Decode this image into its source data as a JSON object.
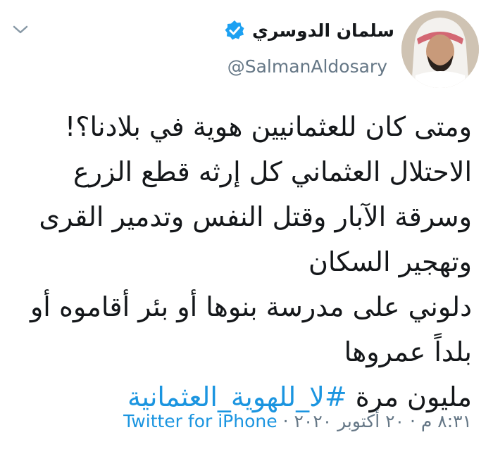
{
  "author": {
    "display_name": "سلمان الدوسري",
    "handle": "@SalmanAldosary",
    "verified_icon": "verified-badge-icon"
  },
  "tweet": {
    "lines": [
      "ومتى كان للعثمانيين هوية في بلادنا؟!",
      "الاحتلال العثماني كل إرثه قطع الزرع",
      "وسرقة الآبار وقتل النفس وتدمير القرى",
      "وتهجير السكان",
      "دلوني على مدرسة بنوها أو بئر أقاموه أو",
      "بلداً عمروها"
    ],
    "last_line_prefix": "مليون مرة ",
    "hashtag": "#لا_للهوية_العثمانية"
  },
  "meta": {
    "time": "٨:٣١ م",
    "separator1": " · ",
    "date": "٢٠ أكتوبر ٢٠٢٠",
    "separator2": " · ",
    "source": "Twitter for iPhone"
  },
  "colors": {
    "link": "#1b95e0",
    "secondary_text": "#657786",
    "primary_text": "#14171a"
  }
}
